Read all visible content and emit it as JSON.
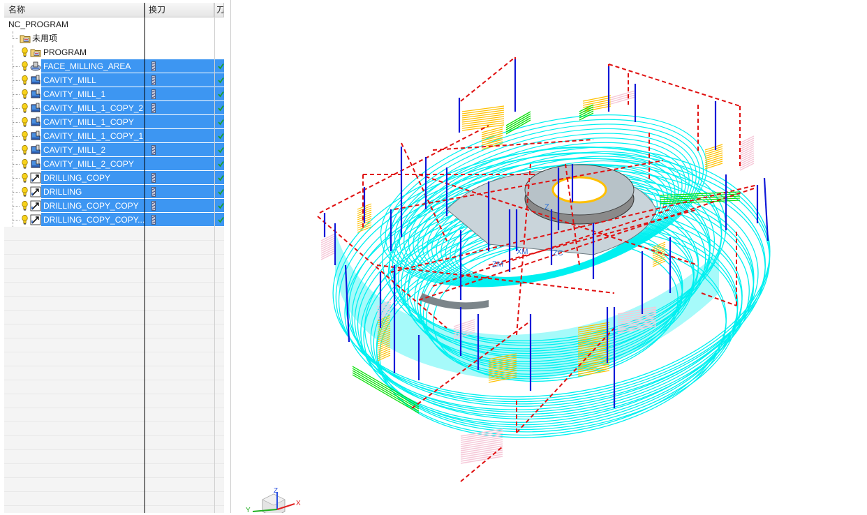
{
  "navigator": {
    "columns": [
      "名称",
      "换刀",
      "刀"
    ],
    "root": "NC_PROGRAM",
    "unused": "未用项",
    "program": "PROGRAM",
    "operations": [
      {
        "name": "FACE_MILLING_AREA",
        "type": "face",
        "tool_change": true
      },
      {
        "name": "CAVITY_MILL",
        "type": "cavity",
        "tool_change": true
      },
      {
        "name": "CAVITY_MILL_1",
        "type": "cavity",
        "tool_change": true
      },
      {
        "name": "CAVITY_MILL_1_COPY_2",
        "type": "cavity",
        "tool_change": true
      },
      {
        "name": "CAVITY_MILL_1_COPY",
        "type": "cavity",
        "tool_change": false
      },
      {
        "name": "CAVITY_MILL_1_COPY_1",
        "type": "cavity",
        "tool_change": false
      },
      {
        "name": "CAVITY_MILL_2",
        "type": "cavity",
        "tool_change": true
      },
      {
        "name": "CAVITY_MILL_2_COPY",
        "type": "cavity",
        "tool_change": false
      },
      {
        "name": "DRILLING_COPY",
        "type": "drill",
        "tool_change": true
      },
      {
        "name": "DRILLING",
        "type": "drill",
        "tool_change": true
      },
      {
        "name": "DRILLING_COPY_COPY",
        "type": "drill",
        "tool_change": true
      },
      {
        "name": "DRILLING_COPY_COPY...",
        "type": "drill",
        "tool_change": true
      }
    ]
  },
  "viewport": {
    "labels": [
      "ZC",
      "ZM",
      "XM",
      "Z"
    ],
    "triad": {
      "z": "Z",
      "x": "X",
      "y": "Y"
    }
  },
  "colors": {
    "selection": "#3d96f2",
    "toolpath_cyan": "#00f0f0",
    "rapid_red": "#e01010",
    "feed_blue": "#1018d8",
    "approach_yellow": "#ffc000",
    "engage_green": "#10e010",
    "retract_pink": "#f5c8d8",
    "part_gray": "#8a8a8a"
  }
}
